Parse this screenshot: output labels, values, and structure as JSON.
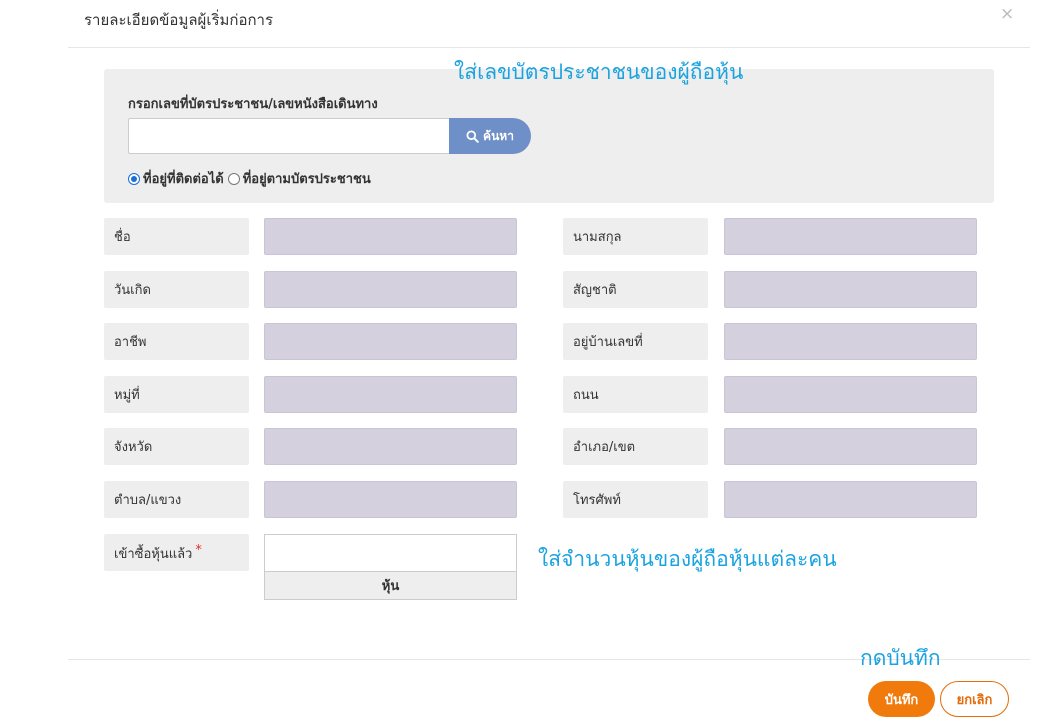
{
  "modal": {
    "title": "รายละเอียดข้อมูลผู้เริ่มก่อการ",
    "close_glyph": "×"
  },
  "search": {
    "label": "กรอกเลขที่บัตรประชาชน/เลขหนังสือเดินทาง",
    "input_value": "",
    "button_label": "ค้นหา",
    "hint": "ใส่เลขบัตรประชาชนของผู้ถือหุ้น",
    "address_options": [
      {
        "label": "ที่อยู่ที่ติดต่อได้",
        "checked": true
      },
      {
        "label": "ที่อยู่ตามบัตรประชาชน",
        "checked": false
      }
    ]
  },
  "fields": {
    "left": [
      {
        "label": "ชื่อ",
        "value": ""
      },
      {
        "label": "วันเกิด",
        "value": ""
      },
      {
        "label": "อาชีพ",
        "value": ""
      },
      {
        "label": "หมู่ที่",
        "value": ""
      },
      {
        "label": "จังหวัด",
        "value": ""
      },
      {
        "label": "ตำบล/แขวง",
        "value": ""
      }
    ],
    "right": [
      {
        "label": "นามสกุล",
        "value": ""
      },
      {
        "label": "สัญชาติ",
        "value": ""
      },
      {
        "label": "อยู่บ้านเลขที่",
        "value": ""
      },
      {
        "label": "ถนน",
        "value": ""
      },
      {
        "label": "อำเภอ/เขต",
        "value": ""
      },
      {
        "label": "โทรศัพท์",
        "value": ""
      }
    ]
  },
  "shares": {
    "label": "เข้าซื้อหุ้นแล้ว",
    "required_mark": "*",
    "value": "",
    "unit": "หุ้น",
    "hint": "ใส่จำนวนหุ้นของผู้ถือหุ้นแต่ละคน"
  },
  "footer": {
    "save_hint": "กดบันทึก",
    "save_label": "บันทึก",
    "cancel_label": "ยกเลิก"
  },
  "colors": {
    "accent_orange": "#f07b0c",
    "hint_blue": "#1aa3e0",
    "search_button": "#6e8fc7",
    "readonly_field": "#d4d0de"
  }
}
